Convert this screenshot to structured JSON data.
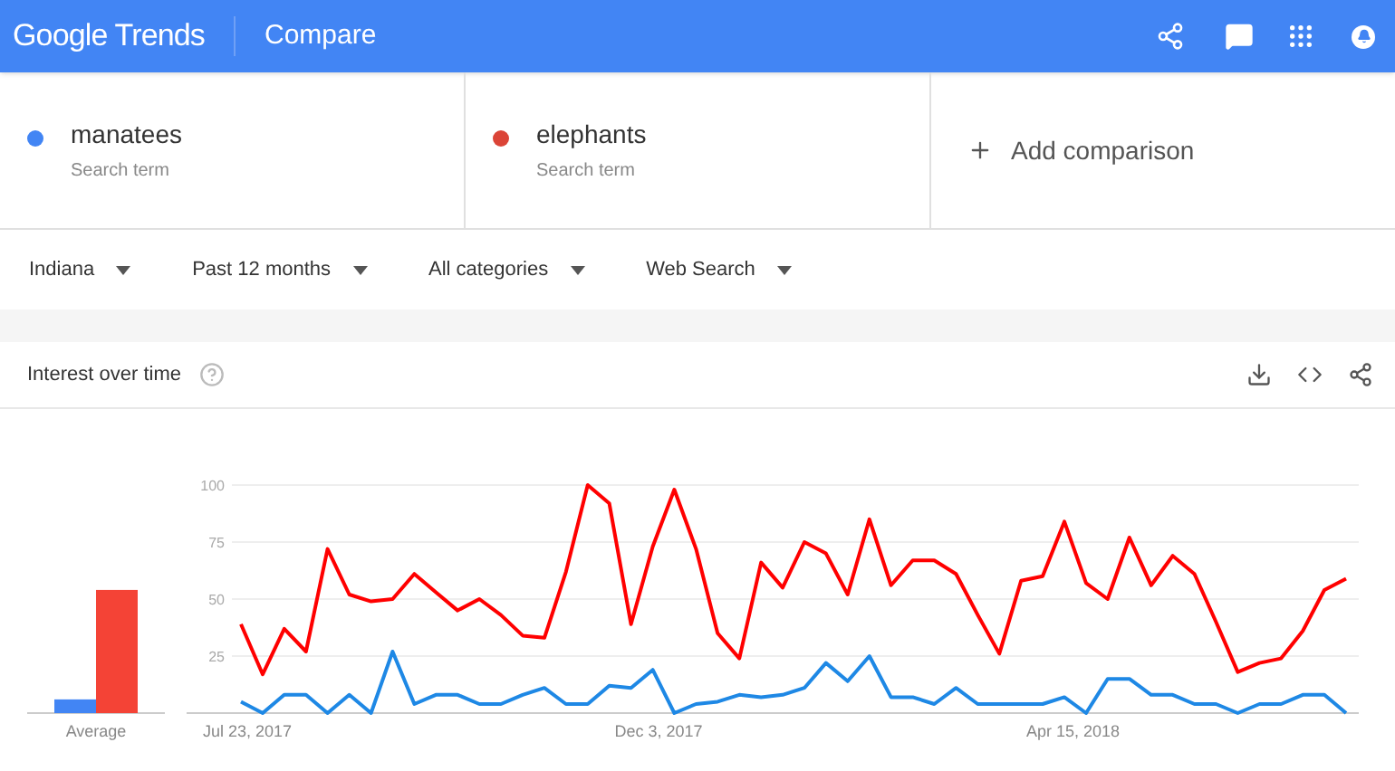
{
  "header": {
    "logo": "Google Trends",
    "title": "Compare"
  },
  "terms": [
    {
      "name": "manatees",
      "subtitle": "Search term",
      "color": "#4285f4"
    },
    {
      "name": "elephants",
      "subtitle": "Search term",
      "color": "#db4437"
    }
  ],
  "add_comparison": "Add comparison",
  "filters": [
    "Indiana",
    "Past 12 months",
    "All categories",
    "Web Search"
  ],
  "interest_card": {
    "title": "Interest over time",
    "average_chart": {
      "chart_data": {
        "type": "bar",
        "categories": [
          "Average"
        ],
        "ylim": [
          0,
          100
        ],
        "series": [
          {
            "color": "#4285f4",
            "values": [
              6
            ]
          },
          {
            "color": "#f44336",
            "values": [
              54
            ]
          }
        ]
      }
    },
    "chart_data": {
      "type": "line",
      "ylim": [
        0,
        100
      ],
      "yticks": [
        25,
        50,
        75,
        100
      ],
      "grid": true,
      "categories": [
        "Jul 23, 2017",
        null,
        null,
        null,
        null,
        null,
        null,
        null,
        null,
        null,
        null,
        null,
        null,
        null,
        null,
        null,
        null,
        null,
        null,
        "Dec 3, 2017",
        null,
        null,
        null,
        null,
        null,
        null,
        null,
        null,
        null,
        null,
        null,
        null,
        null,
        null,
        null,
        null,
        null,
        null,
        "Apr 15, 2018",
        null,
        null,
        null,
        null,
        null,
        null,
        null,
        null,
        null,
        null,
        null,
        null,
        null
      ],
      "series": [
        {
          "color": "#1e88e5",
          "values": [
            5,
            0,
            8,
            8,
            0,
            8,
            0,
            27,
            4,
            8,
            8,
            4,
            4,
            8,
            11,
            4,
            4,
            12,
            11,
            19,
            0,
            4,
            5,
            8,
            7,
            8,
            11,
            22,
            14,
            25,
            7,
            7,
            4,
            11,
            4,
            4,
            4,
            4,
            7,
            0,
            15,
            15,
            8,
            8,
            4,
            4,
            0,
            4,
            4,
            8,
            8,
            0
          ]
        },
        {
          "color": "#ff0000",
          "values": [
            39,
            17,
            37,
            27,
            72,
            52,
            49,
            50,
            61,
            53,
            45,
            50,
            43,
            34,
            33,
            62,
            100,
            92,
            39,
            73,
            98,
            72,
            35,
            24,
            66,
            55,
            75,
            70,
            52,
            85,
            56,
            67,
            67,
            61,
            43,
            26,
            58,
            60,
            84,
            57,
            50,
            77,
            56,
            69,
            61,
            40,
            18,
            22,
            24,
            36,
            54,
            59
          ]
        }
      ]
    }
  }
}
